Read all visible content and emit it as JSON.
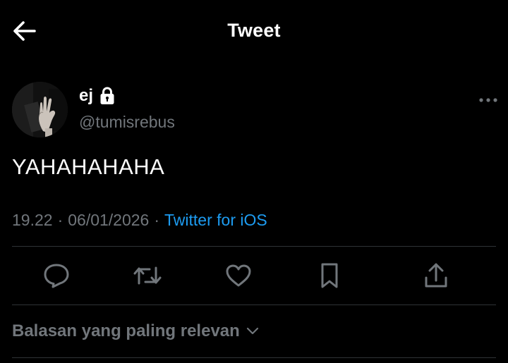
{
  "header": {
    "title": "Tweet",
    "back_icon": "arrow-left-icon"
  },
  "author": {
    "display_name": "ej",
    "handle": "@tumisrebus",
    "protected_icon": "lock-icon",
    "avatar": "profile-photo-hand-gesture"
  },
  "tweet": {
    "text": "YAHAHAHAHA",
    "time": "19.22",
    "separator": "·",
    "date": "06/01/2026",
    "source": "Twitter for iOS"
  },
  "actions": [
    {
      "name": "reply",
      "icon": "reply-icon"
    },
    {
      "name": "retweet",
      "icon": "retweet-icon"
    },
    {
      "name": "like",
      "icon": "heart-icon"
    },
    {
      "name": "bookmark",
      "icon": "bookmark-icon"
    },
    {
      "name": "share",
      "icon": "share-icon"
    }
  ],
  "replies": {
    "sort_label": "Balasan yang paling relevan",
    "sort_icon": "chevron-down-icon"
  },
  "colors": {
    "background": "#000000",
    "text_primary": "#ffffff",
    "text_secondary": "#71767b",
    "accent": "#1d9bf0",
    "divider": "#2f3336"
  }
}
